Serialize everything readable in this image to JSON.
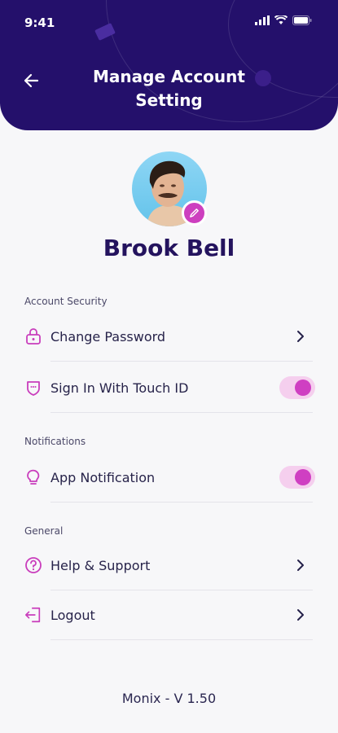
{
  "status_bar": {
    "time": "9:41"
  },
  "header": {
    "title": "Manage Account Setting"
  },
  "profile": {
    "name": "Brook Bell"
  },
  "sections": {
    "account_security": {
      "label": "Account Security",
      "change_password": "Change Password",
      "touch_id": "Sign In With Touch ID",
      "touch_id_enabled": true
    },
    "notifications": {
      "label": "Notifications",
      "app_notification": "App Notification",
      "app_notification_enabled": true
    },
    "general": {
      "label": "General",
      "help_support": "Help & Support",
      "logout": "Logout"
    }
  },
  "footer": {
    "version": "Monix - V 1.50"
  },
  "colors": {
    "header_bg": "#24106b",
    "accent": "#cd3fbf",
    "toggle_track": "#f5cfee",
    "text_dark": "#24135e"
  },
  "icons": {
    "back": "arrow-left-icon",
    "lock": "lock-icon",
    "touch_id": "shield-face-icon",
    "bulb": "lightbulb-icon",
    "help": "question-circle-icon",
    "logout": "logout-icon",
    "chevron": "chevron-right-icon",
    "edit": "pencil-icon"
  }
}
